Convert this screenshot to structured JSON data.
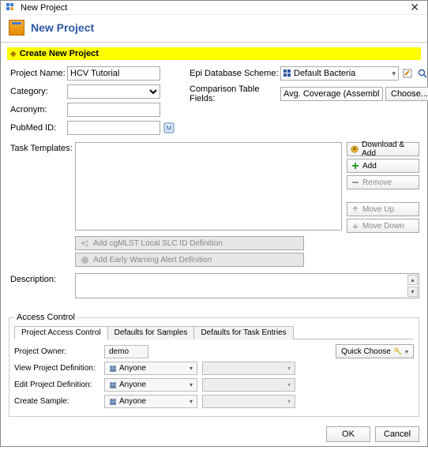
{
  "window": {
    "title": "New Project"
  },
  "header": {
    "title": "New Project"
  },
  "banner": {
    "text": "Create New Project"
  },
  "form": {
    "projectName": {
      "label": "Project Name:",
      "value": "HCV Tutorial"
    },
    "category": {
      "label": "Category:",
      "value": ""
    },
    "acronym": {
      "label": "Acronym:",
      "value": ""
    },
    "pubmed": {
      "label": "PubMed ID:",
      "value": ""
    },
    "epiScheme": {
      "label": "Epi Database Scheme:",
      "value": "Default Bacteria"
    },
    "compFields": {
      "label": "Comparison Table Fields:",
      "value": "Avg. Coverage (Assembled), Approximate"
    },
    "chooseBtn": "Choose...",
    "taskTemplates": {
      "label": "Task Templates:",
      "buttons": {
        "downloadAdd": "Download & Add",
        "add": "Add",
        "remove": "Remove",
        "moveUp": "Move Up",
        "moveDown": "Move Down"
      },
      "belowButtons": {
        "addCgmlst": "Add cgMLST Local SLC ID Definition",
        "addEarlyWarning": "Add Early Warning Alert Definition"
      }
    },
    "description": {
      "label": "Description:"
    }
  },
  "accessControl": {
    "legend": "Access Control",
    "tabs": [
      "Project Access Control",
      "Defaults for Samples",
      "Defaults for Task Entries"
    ],
    "quickChoose": "Quick Choose",
    "projectOwner": {
      "label": "Project Owner:",
      "value": "demo"
    },
    "viewDef": {
      "label": "View Project Definition:",
      "value": "Anyone"
    },
    "editDef": {
      "label": "Edit Project Definition:",
      "value": "Anyone"
    },
    "createSample": {
      "label": "Create Sample:",
      "value": "Anyone"
    }
  },
  "footer": {
    "ok": "OK",
    "cancel": "Cancel"
  }
}
